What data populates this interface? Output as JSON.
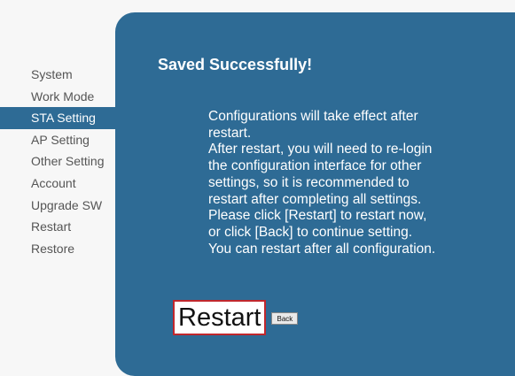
{
  "sidebar": {
    "items": [
      {
        "label": "System"
      },
      {
        "label": "Work Mode"
      },
      {
        "label": "STA Setting",
        "active": true
      },
      {
        "label": "AP Setting"
      },
      {
        "label": "Other Setting"
      },
      {
        "label": "Account"
      },
      {
        "label": "Upgrade SW"
      },
      {
        "label": "Restart"
      },
      {
        "label": "Restore"
      }
    ]
  },
  "main": {
    "title": "Saved Successfully!",
    "message_lines": [
      "Configurations will take effect after",
      "restart.",
      "After restart, you will need to re-login",
      "the configuration interface for other",
      "settings, so it is recommended to",
      "restart after completing all settings.",
      "Please click [Restart] to restart now,",
      "or click [Back] to continue setting.",
      "You can restart after all configuration."
    ],
    "restart_label": "Restart",
    "back_label": "Back"
  },
  "colors": {
    "panel_bg": "#2e6b95",
    "active_item_bg": "#2e6b95",
    "restart_border": "#c0272d"
  }
}
